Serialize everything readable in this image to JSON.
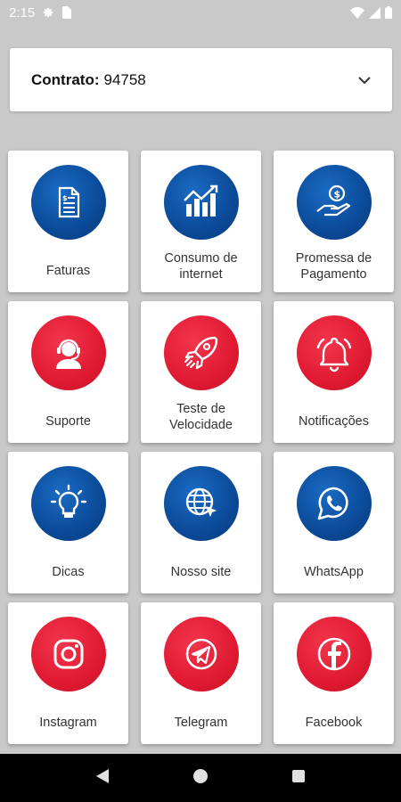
{
  "status": {
    "time": "2:15"
  },
  "contract": {
    "label": "Contrato:",
    "value": "94758"
  },
  "tiles": [
    {
      "label": "Faturas",
      "icon": "invoice-icon",
      "color": "blue"
    },
    {
      "label": "Consumo de internet",
      "icon": "chart-growth-icon",
      "color": "blue"
    },
    {
      "label": "Promessa de Pagamento",
      "icon": "hand-coin-icon",
      "color": "blue"
    },
    {
      "label": "Suporte",
      "icon": "support-agent-icon",
      "color": "red"
    },
    {
      "label": "Teste de Velocidade",
      "icon": "rocket-icon",
      "color": "red"
    },
    {
      "label": "Notificações",
      "icon": "bell-icon",
      "color": "red"
    },
    {
      "label": "Dicas",
      "icon": "lightbulb-icon",
      "color": "blue"
    },
    {
      "label": "Nosso site",
      "icon": "globe-cursor-icon",
      "color": "blue"
    },
    {
      "label": "WhatsApp",
      "icon": "whatsapp-icon",
      "color": "blue"
    },
    {
      "label": "Instagram",
      "icon": "instagram-icon",
      "color": "red"
    },
    {
      "label": "Telegram",
      "icon": "telegram-icon",
      "color": "red"
    },
    {
      "label": "Facebook",
      "icon": "facebook-icon",
      "color": "red"
    }
  ],
  "colors": {
    "blue": "#0b4a98",
    "red": "#e01a32",
    "background": "#c9c9c9"
  }
}
